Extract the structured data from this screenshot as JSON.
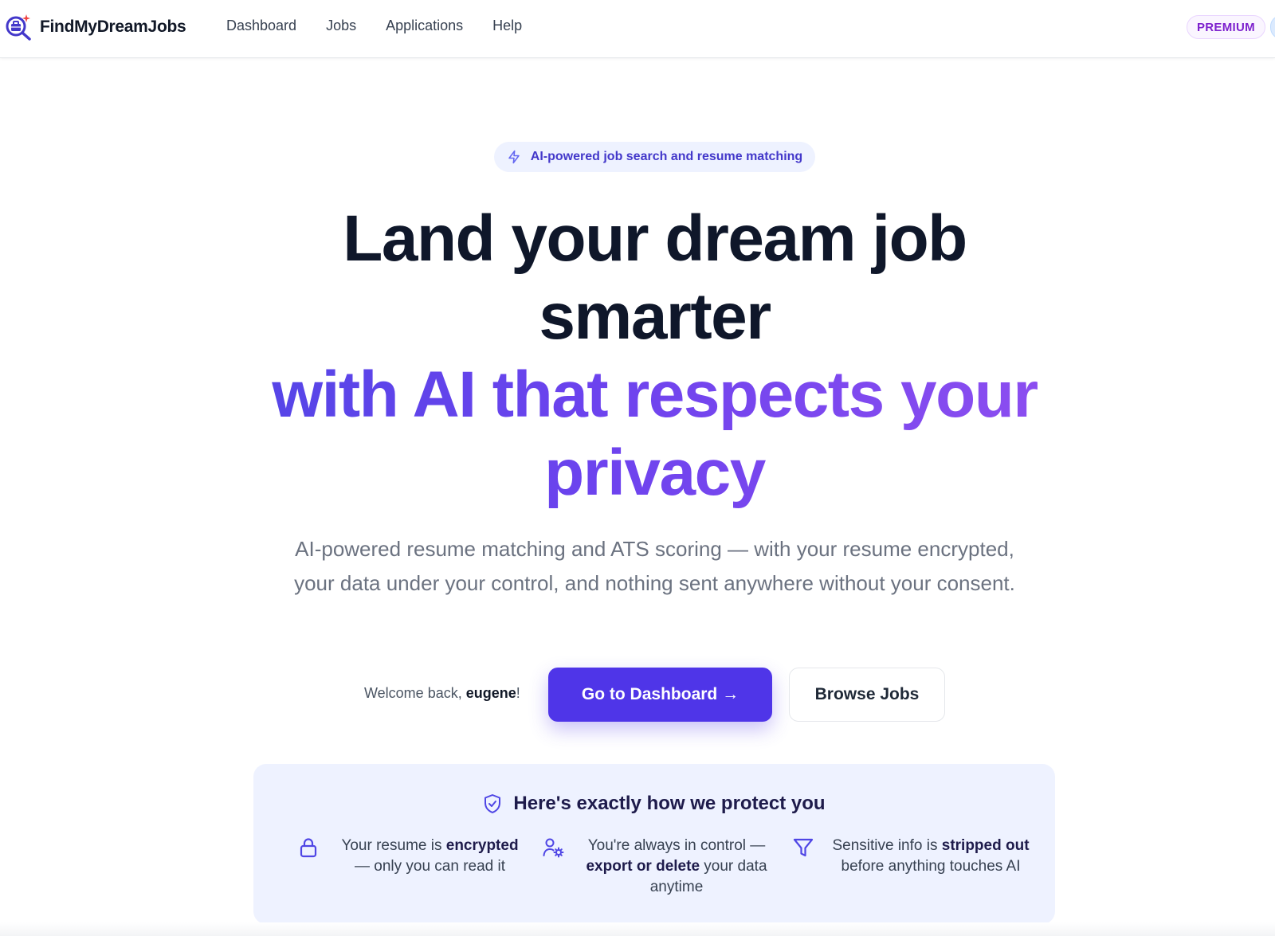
{
  "nav": {
    "brand": "FindMyDreamJobs",
    "links": [
      "Dashboard",
      "Jobs",
      "Applications",
      "Help"
    ],
    "badge": "PREMIUM"
  },
  "hero": {
    "pill": "AI-powered job search and resume matching",
    "headline_line1": "Land your dream job",
    "headline_line2": "smarter",
    "headline_line3": "with AI that respects your",
    "headline_line4": "privacy",
    "subtext": "AI-powered resume matching and ATS scoring — with your resume encrypted, your data under your control, and nothing sent anywhere without your consent.",
    "welcome_prefix": "Welcome back, ",
    "username": "eugene",
    "welcome_suffix": "!",
    "primary_button": "Go to Dashboard →",
    "secondary_button": "Browse Jobs"
  },
  "protect": {
    "title": "Here's exactly how we protect you",
    "features": [
      {
        "icon": "lock-icon",
        "before": "Your resume is ",
        "bold": "encrypted",
        "after": " — only you can read it"
      },
      {
        "icon": "user-settings-icon",
        "before": "You're always in control — ",
        "bold": "export or delete",
        "after": " your data anytime"
      },
      {
        "icon": "filter-icon",
        "before": "Sensitive info is ",
        "bold": "stripped out",
        "after": " before anything touches AI"
      }
    ]
  },
  "colors": {
    "primary": "#4f35e8",
    "gradient_start": "#4f46e5",
    "gradient_end": "#9350f0",
    "heading": "#0f172a",
    "panel_bg": "#eef2ff",
    "premium": "#7e22ce"
  }
}
